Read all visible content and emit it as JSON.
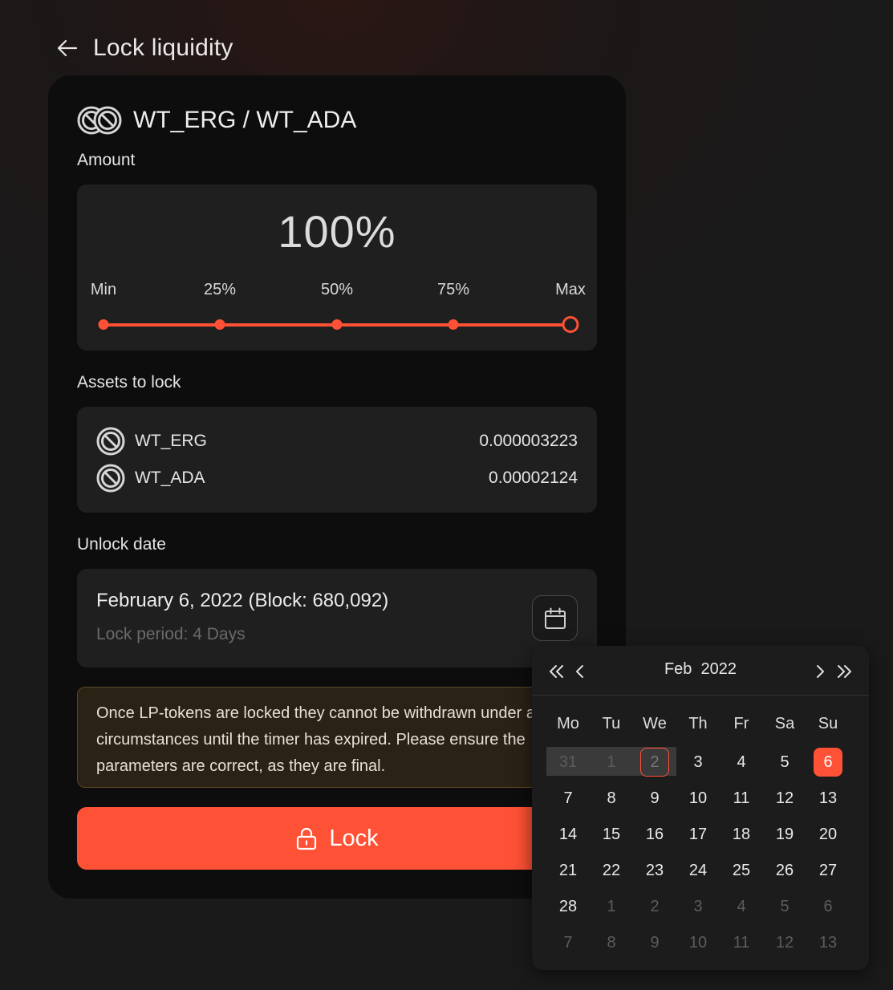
{
  "header": {
    "title": "Lock liquidity"
  },
  "pair": {
    "name": "WT_ERG / WT_ADA"
  },
  "amount": {
    "label": "Amount",
    "value": "100%",
    "percent": 100,
    "marks": [
      "Min",
      "25%",
      "50%",
      "75%",
      "Max"
    ]
  },
  "assets": {
    "label": "Assets to lock",
    "items": [
      {
        "name": "WT_ERG",
        "amount": "0.000003223"
      },
      {
        "name": "WT_ADA",
        "amount": "0.00002124"
      }
    ]
  },
  "unlock": {
    "label": "Unlock date",
    "date": "February 6, 2022 (Block: 680,092)",
    "period": "Lock period: 4 Days"
  },
  "warning": "Once LP-tokens are locked they cannot be withdrawn under any circumstances until the timer has expired. Please ensure the parameters are correct, as they are final.",
  "lock_button": {
    "label": "Lock"
  },
  "calendar": {
    "month": "Feb",
    "year": "2022",
    "weekdays": [
      "Mo",
      "Tu",
      "We",
      "Th",
      "Fr",
      "Sa",
      "Su"
    ],
    "weeks": [
      [
        "31",
        "1",
        "2",
        "3",
        "4",
        "5",
        "6"
      ],
      [
        "7",
        "8",
        "9",
        "10",
        "11",
        "12",
        "13"
      ],
      [
        "14",
        "15",
        "16",
        "17",
        "18",
        "19",
        "20"
      ],
      [
        "21",
        "22",
        "23",
        "24",
        "25",
        "26",
        "27"
      ],
      [
        "28",
        "1",
        "2",
        "3",
        "4",
        "5",
        "6"
      ],
      [
        "7",
        "8",
        "9",
        "10",
        "11",
        "12",
        "13"
      ]
    ],
    "disabled_days": [
      "31",
      "1"
    ],
    "today": "2",
    "selected": "6",
    "colors": {
      "accent": "#ff5135"
    }
  }
}
